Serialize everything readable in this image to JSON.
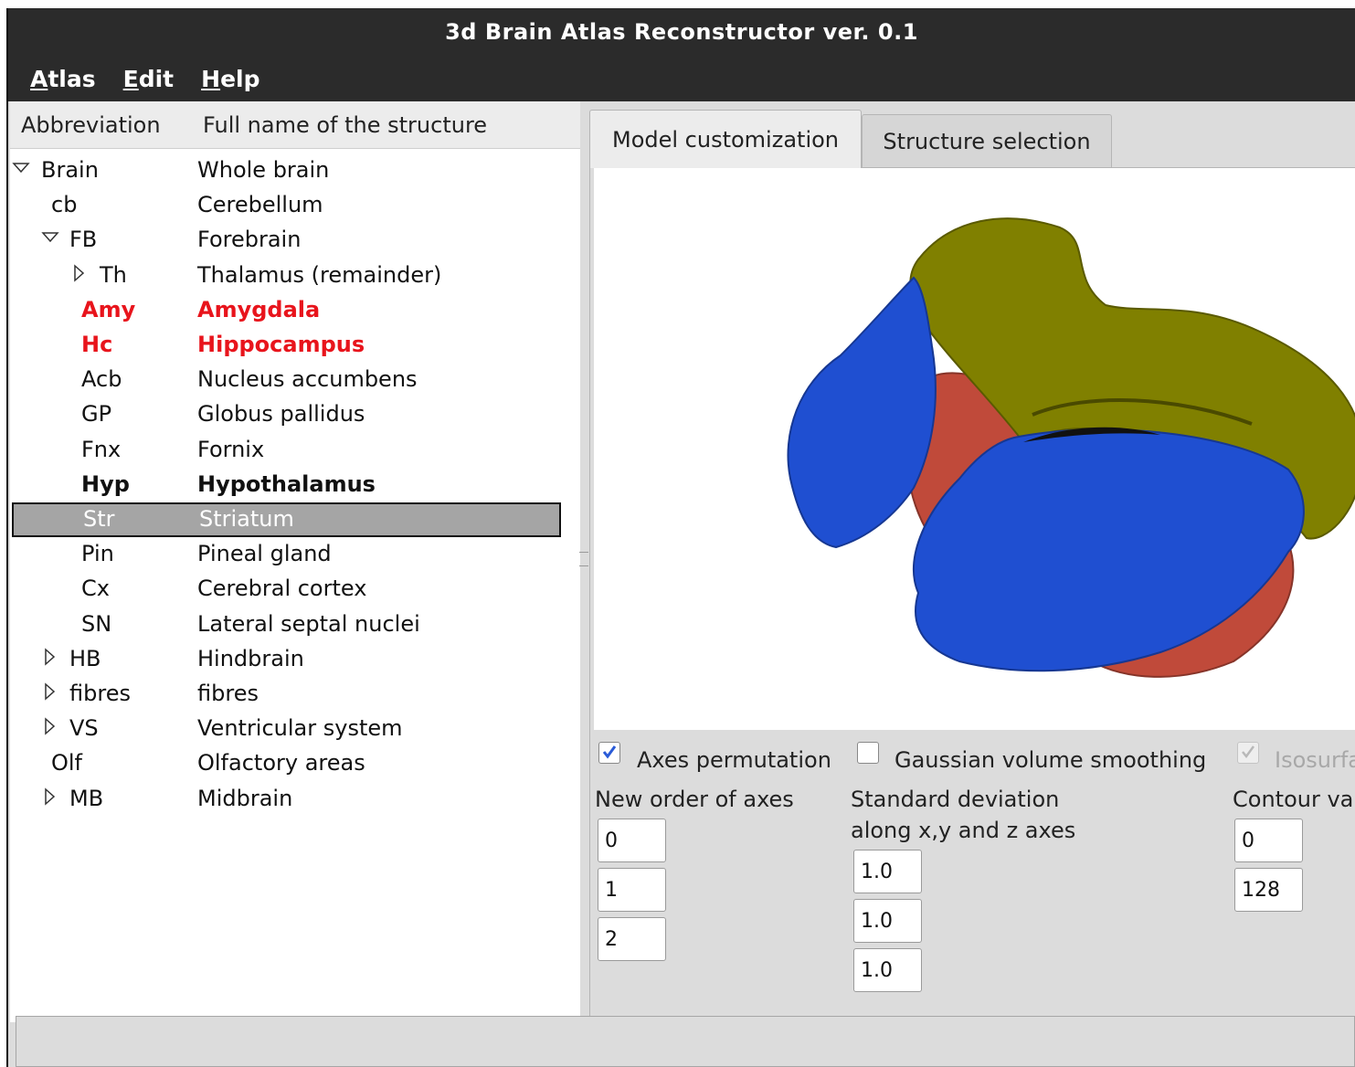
{
  "window": {
    "title": "3d Brain Atlas Reconstructor ver. 0.1"
  },
  "menu": [
    {
      "mnemonic": "A",
      "rest": "tlas"
    },
    {
      "mnemonic": "E",
      "rest": "dit"
    },
    {
      "mnemonic": "H",
      "rest": "elp"
    }
  ],
  "tree": {
    "headers": {
      "abbreviation": "Abbreviation",
      "full_name": "Full name of the structure"
    },
    "rows": [
      {
        "abbr": "Brain",
        "full": "Whole brain",
        "depth": 0,
        "arrow": "expanded",
        "style": "normal"
      },
      {
        "abbr": "cb",
        "full": "Cerebellum",
        "depth": 1,
        "arrow": "none",
        "style": "normal"
      },
      {
        "abbr": "FB",
        "full": "Forebrain",
        "depth": 1,
        "arrow": "expanded",
        "style": "normal"
      },
      {
        "abbr": "Th",
        "full": "Thalamus (remainder)",
        "depth": 2,
        "arrow": "collapsed",
        "style": "normal"
      },
      {
        "abbr": "Amy",
        "full": "Amygdala",
        "depth": 2,
        "arrow": "none",
        "style": "red"
      },
      {
        "abbr": "Hc",
        "full": "Hippocampus",
        "depth": 2,
        "arrow": "none",
        "style": "red"
      },
      {
        "abbr": "Acb",
        "full": "Nucleus accumbens",
        "depth": 2,
        "arrow": "none",
        "style": "normal"
      },
      {
        "abbr": "GP",
        "full": "Globus pallidus",
        "depth": 2,
        "arrow": "none",
        "style": "normal"
      },
      {
        "abbr": "Fnx",
        "full": "Fornix",
        "depth": 2,
        "arrow": "none",
        "style": "normal"
      },
      {
        "abbr": "Hyp",
        "full": "Hypothalamus",
        "depth": 2,
        "arrow": "none",
        "style": "bold"
      },
      {
        "abbr": "Str",
        "full": "Striatum",
        "depth": 2,
        "arrow": "none",
        "style": "selected"
      },
      {
        "abbr": "Pin",
        "full": "Pineal gland",
        "depth": 2,
        "arrow": "none",
        "style": "normal"
      },
      {
        "abbr": "Cx",
        "full": "Cerebral cortex",
        "depth": 2,
        "arrow": "none",
        "style": "normal"
      },
      {
        "abbr": "SN",
        "full": "Lateral septal nuclei",
        "depth": 2,
        "arrow": "none",
        "style": "normal"
      },
      {
        "abbr": "HB",
        "full": "Hindbrain",
        "depth": 1,
        "arrow": "collapsed",
        "style": "normal"
      },
      {
        "abbr": "fibres",
        "full": "fibres",
        "depth": 1,
        "arrow": "collapsed",
        "style": "normal"
      },
      {
        "abbr": "VS",
        "full": "Ventricular system",
        "depth": 1,
        "arrow": "collapsed",
        "style": "normal"
      },
      {
        "abbr": "Olf",
        "full": "Olfactory areas",
        "depth": 1,
        "arrow": "none",
        "style": "normal"
      },
      {
        "abbr": "MB",
        "full": "Midbrain",
        "depth": 1,
        "arrow": "collapsed",
        "style": "normal"
      }
    ]
  },
  "tabs": [
    {
      "label": "Model customization",
      "active": true
    },
    {
      "label": "Structure selection",
      "active": false
    }
  ],
  "viewport": {
    "colors": {
      "blue": "#1f4fd1",
      "olive": "#808000",
      "red": "#c04a3a"
    }
  },
  "options": {
    "axes_permutation": {
      "label": "Axes permutation",
      "checked": true
    },
    "gaussian_smoothing": {
      "label": "Gaussian volume smoothing",
      "checked": false
    },
    "isosurface": {
      "label": "Isosurfa",
      "checked": true,
      "disabled": true
    }
  },
  "axes": {
    "label": "New order of axes",
    "values": [
      "0",
      "1",
      "2"
    ]
  },
  "stddev": {
    "label_line1": "Standard deviation",
    "label_line2": "along x,y and z axes",
    "values": [
      "1.0",
      "1.0",
      "1.0"
    ]
  },
  "contour": {
    "label": "Contour va",
    "values": [
      "0",
      "128"
    ]
  },
  "status": {
    "text": ""
  }
}
